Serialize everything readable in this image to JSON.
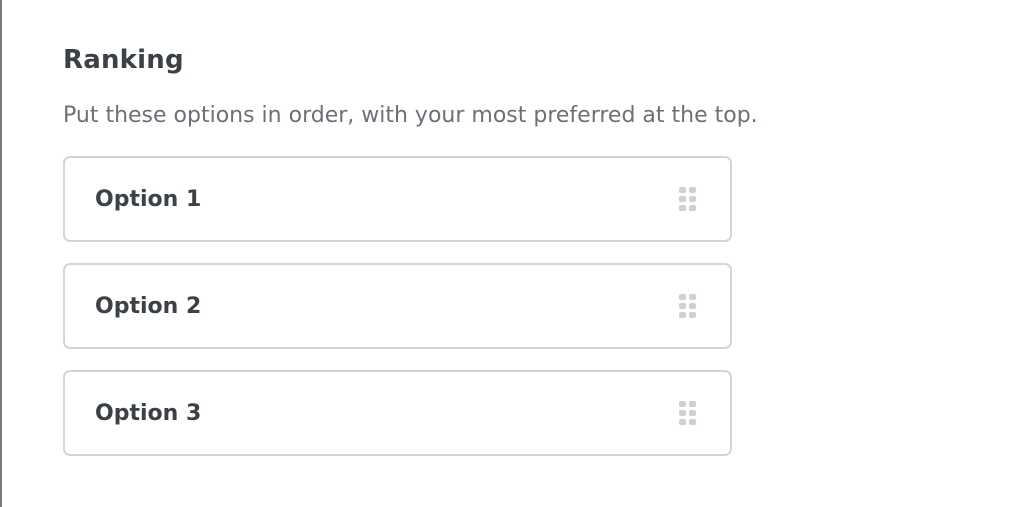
{
  "question": {
    "title": "Ranking",
    "description": "Put these options in order, with your most preferred at the top."
  },
  "ranking_options": [
    {
      "label": "Option 1",
      "icon": "drag-handle-icon"
    },
    {
      "label": "Option 2",
      "icon": "drag-handle-icon"
    },
    {
      "label": "Option 3",
      "icon": "drag-handle-icon"
    }
  ],
  "colors": {
    "title_text": "#3b4147",
    "description_text": "#6b7178",
    "option_border": "#d3d5d8",
    "drag_handle": "#cdd0d4",
    "frame_border": "#7a7a7a"
  }
}
